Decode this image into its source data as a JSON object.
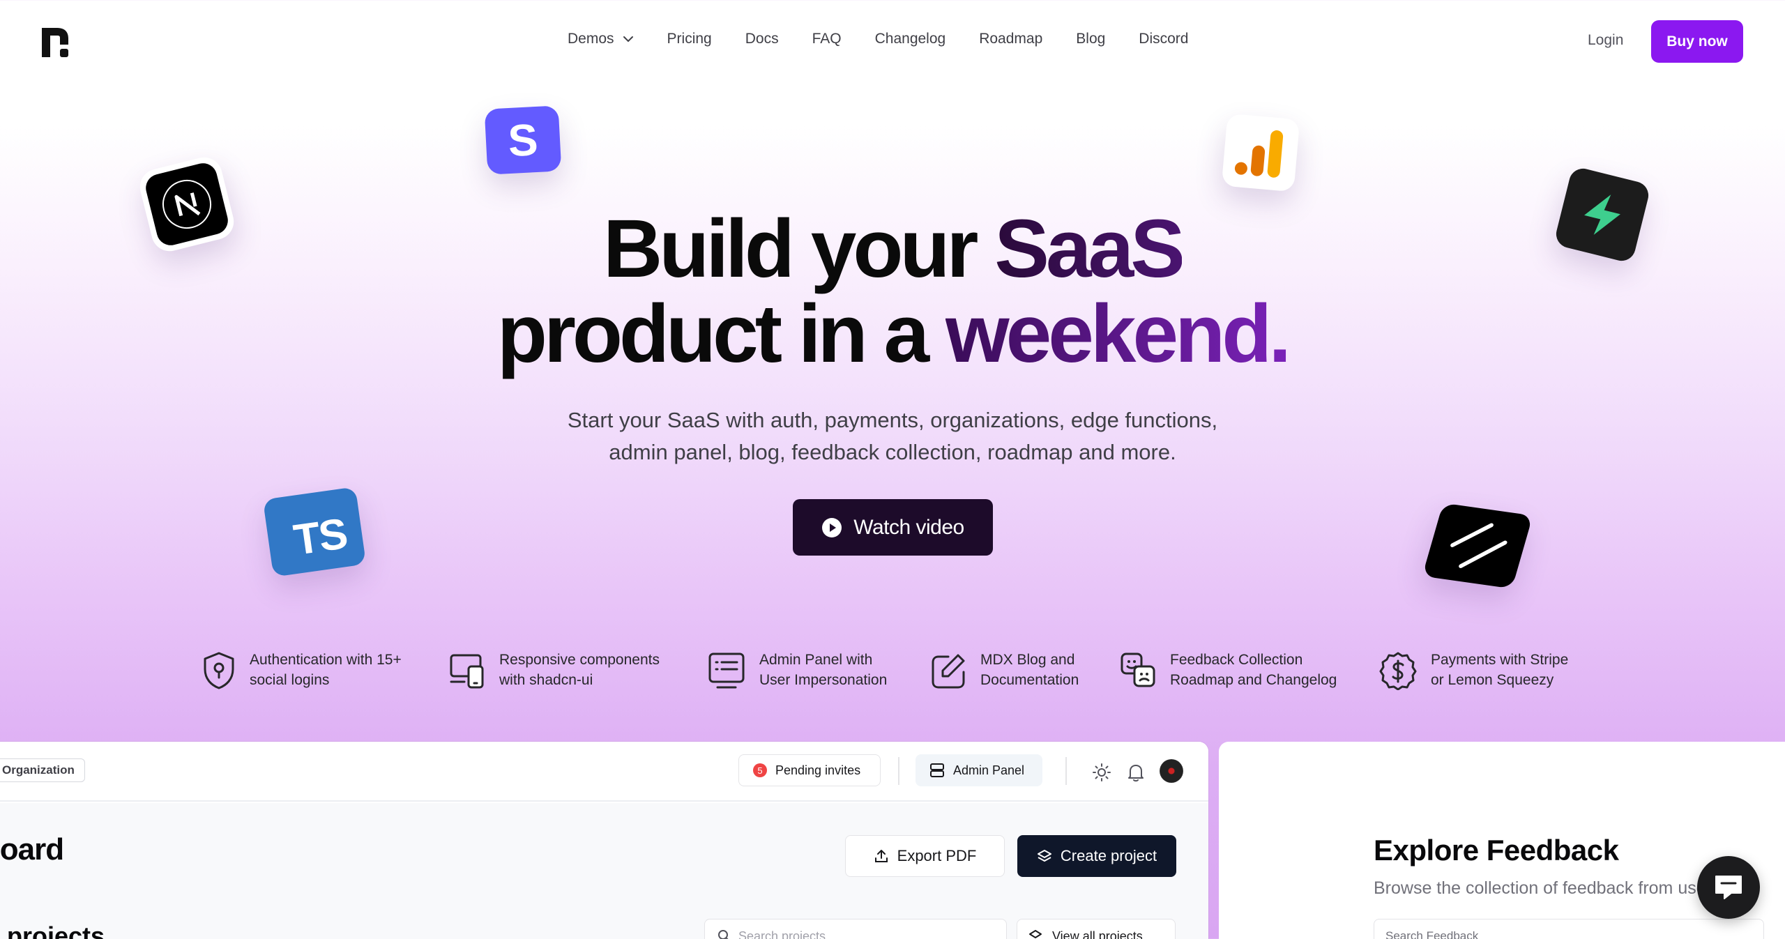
{
  "nav": {
    "links": [
      {
        "label": "Demos",
        "has_dropdown": true
      },
      {
        "label": "Pricing"
      },
      {
        "label": "Docs"
      },
      {
        "label": "FAQ"
      },
      {
        "label": "Changelog"
      },
      {
        "label": "Roadmap"
      },
      {
        "label": "Blog"
      },
      {
        "label": "Discord"
      }
    ],
    "login_label": "Login",
    "buy_label": "Buy now"
  },
  "tiles": {
    "stripe_letter": "S",
    "typescript_label": "TS"
  },
  "hero": {
    "title_line1_a": "Build your ",
    "title_line1_b": "SaaS",
    "title_line2_a": "product in a ",
    "title_line2_b": "weekend.",
    "subtitle_line1": "Start your SaaS with auth, payments, organizations, edge functions,",
    "subtitle_line2": "admin panel, blog, feedback collection, roadmap and more.",
    "cta_label": "Watch video"
  },
  "features": [
    {
      "icon": "shield-icon",
      "line1": "Authentication with 15+",
      "line2": "social logins"
    },
    {
      "icon": "devices-icon",
      "line1": "Responsive components",
      "line2": "with shadcn-ui"
    },
    {
      "icon": "admin-panel-icon",
      "line1": "Admin Panel with",
      "line2": "User Impersonation"
    },
    {
      "icon": "edit-icon",
      "line1": "MDX Blog and",
      "line2": "Documentation"
    },
    {
      "icon": "feedback-icon",
      "line1": "Feedback Collection",
      "line2": "Roadmap and Changelog"
    },
    {
      "icon": "dollar-icon",
      "line1": "Payments with Stripe",
      "line2": "or Lemon Squeezy"
    }
  ],
  "dashboard": {
    "org_chip": "Organization",
    "pending_count": "5",
    "pending_label": "Pending invites",
    "admin_label": "Admin Panel",
    "title": "nboard",
    "export_label": "Export PDF",
    "create_label": "Create project",
    "recent_title": "nt projects",
    "search_placeholder": "Search projects",
    "view_all_label": "View all projects"
  },
  "feedback": {
    "title": "Explore Feedback",
    "subtitle": "Browse the collection of feedback from users",
    "search_placeholder": "Search Feedback"
  },
  "colors": {
    "brand": "#8b18f0",
    "cta_dark": "#1d0b2a",
    "dark_button": "#0f172a"
  }
}
